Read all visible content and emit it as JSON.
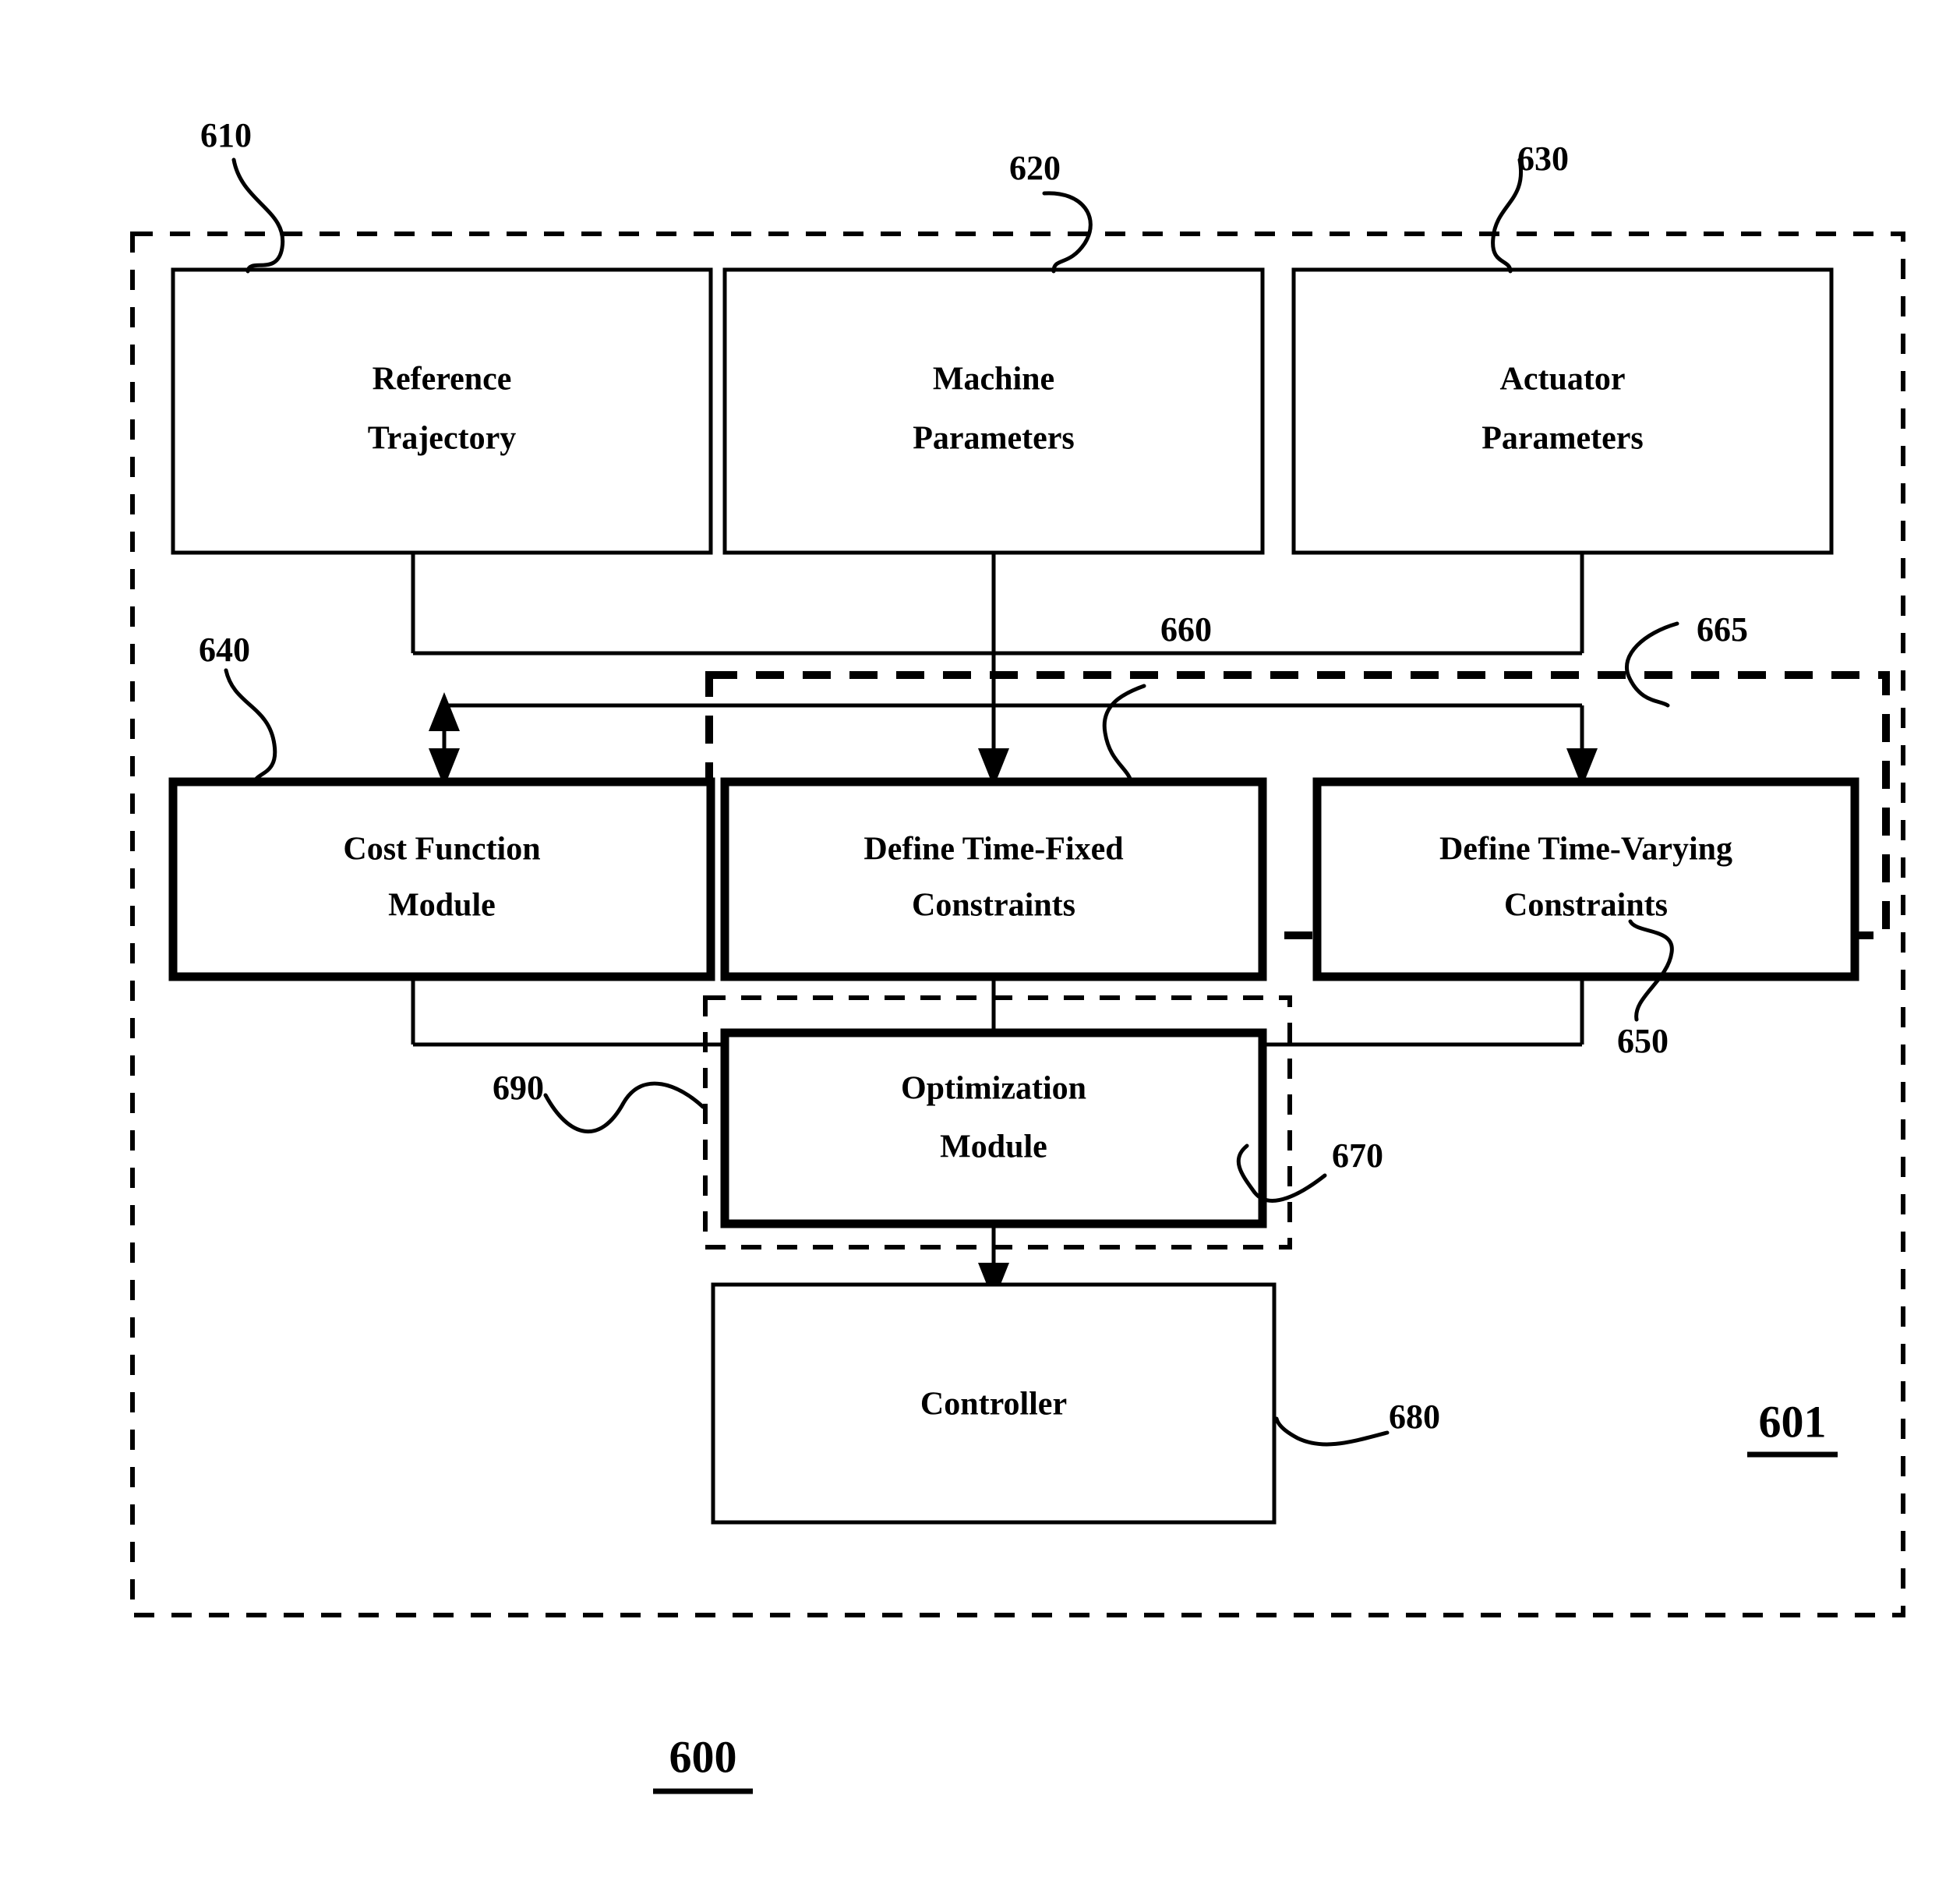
{
  "figure": {
    "figure_number": "600",
    "system_number": "601"
  },
  "boxes": {
    "reference_trajectory": {
      "ref": "610",
      "line1": "Reference",
      "line2": "Trajectory"
    },
    "machine_parameters": {
      "ref": "620",
      "line1": "Machine",
      "line2": "Parameters"
    },
    "actuator_parameters": {
      "ref": "630",
      "line1": "Actuator",
      "line2": "Parameters"
    },
    "cost_function_module": {
      "ref": "640",
      "line1": "Cost Function",
      "line2": "Module"
    },
    "time_fixed_constraints": {
      "ref": "660",
      "line1": "Define Time-Fixed",
      "line2": "Constraints"
    },
    "time_varying_constraints": {
      "ref": "665",
      "line1": "Define Time-Varying",
      "line2": "Constraints"
    },
    "optimization_module": {
      "ref": "670",
      "line1": "Optimization",
      "line2": "Module"
    },
    "controller": {
      "ref": "680",
      "line1": "Controller",
      "line2": ""
    }
  },
  "group_refs": {
    "constraints_group": "650",
    "optimization_group": "690"
  }
}
